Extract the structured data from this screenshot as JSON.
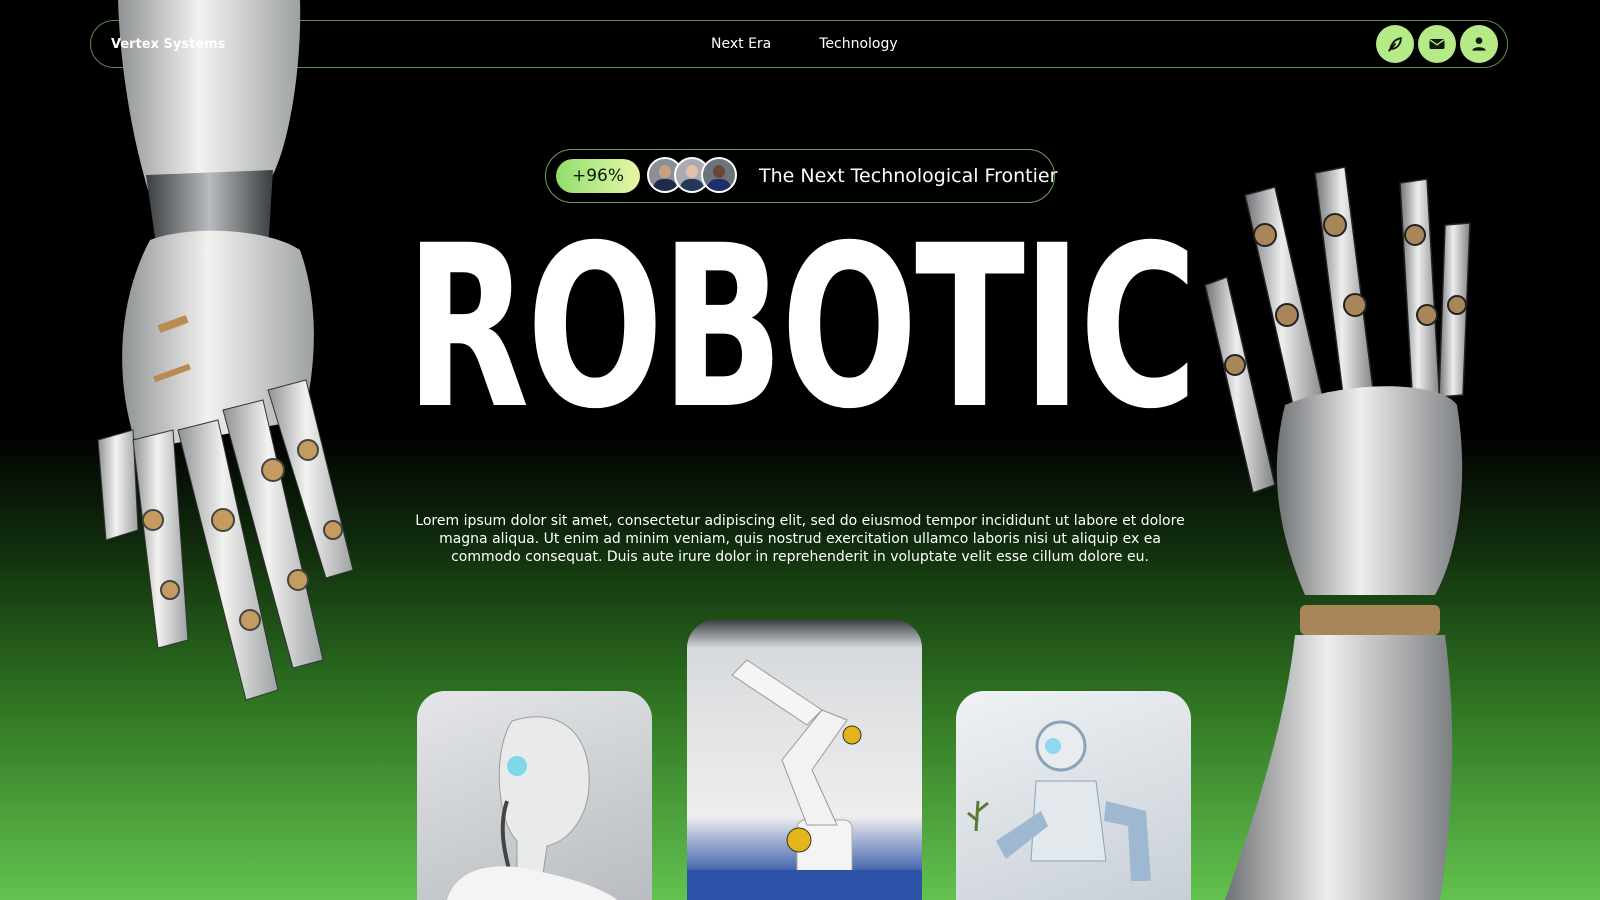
{
  "nav": {
    "brand": "Vertex Systems",
    "links": [
      "Next Era",
      "Technology"
    ],
    "icons": [
      "leaf-icon",
      "mail-icon",
      "user-icon"
    ]
  },
  "hero": {
    "badge_percent": "+96%",
    "tagline": "The Next Technological Frontier",
    "headline": "ROBOTIC",
    "paragraph": "Lorem ipsum dolor sit amet, consectetur adipiscing elit, sed do eiusmod tempor incididunt ut labore et dolore magna aliqua. Ut enim ad minim veniam, quis nostrud exercitation ullamco laboris nisi ut aliquip ex ea commodo consequat. Duis aute irure dolor in reprehenderit in voluptate velit esse cillum dolore eu."
  },
  "colors": {
    "accent": "#b6ea86",
    "background_top": "#000000",
    "background_bottom": "#63c24f"
  }
}
